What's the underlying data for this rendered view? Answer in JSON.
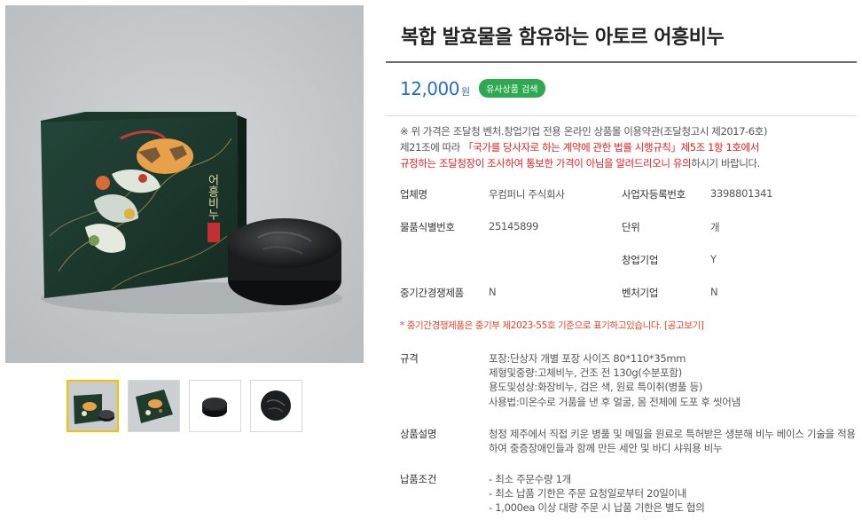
{
  "product": {
    "title": "복합 발효물을 함유하는 아토르 어흥비누",
    "price": "12,000",
    "currency": "원",
    "similar_button": "유사상품 검색"
  },
  "notice": {
    "line1": "※ 위 가격은 조달청 벤처.창업기업 전용 온라인 상품몰 이용약관(조달청고시 제2017-6호)",
    "line2_prefix": "제21조에 따라 ",
    "line2_red": "「국가를 당사자로 하는 계약에 관한 법률 시행규칙」제5조 1항 1호에서",
    "line3_red": "규정하는 조달청장이 조사하여 통보한 가격이 아님을 알려드리오니 유의",
    "line3_suffix": "하시기 바랍니다."
  },
  "info": {
    "company_label": "업체명",
    "company_value": "우컴퍼니 주식회사",
    "bizno_label": "사업자등록번호",
    "bizno_value": "3398801341",
    "itemno_label": "물품식별번호",
    "itemno_value": "25145899",
    "unit_label": "단위",
    "unit_value": "개",
    "startup_label": "창업기업",
    "startup_value": "Y",
    "smb_label": "중기간경쟁제품",
    "smb_value": "N",
    "venture_label": "벤처기업",
    "venture_value": "N"
  },
  "smb_note": "* 중기간경쟁제품은 중기부 제2023-55호 기준으로 표기하고있습니다. [공고보기]",
  "spec": {
    "label": "규격",
    "lines": [
      "포장:단상자 개별 포장 사이즈 80*110*35mm",
      "제형및중량:고체비누, 건조 전 130g(수분포함)",
      "용도및성상:화장비누, 검은 색, 원료 특이취(병풀 등)",
      "사용법:미온수로 거품을 낸 후 얼굴, 몸 전체에 도포 후 씻어냄"
    ]
  },
  "description": {
    "label": "상품설명",
    "text": "청정 제주에서 직접 키운 병풀 및 메밀을 원료로 특허받은 생분해 비누 베이스 기술을 적용하여 중증장애인들과 함께 만든 세안 및 바디 샤워용 비누"
  },
  "conditions": {
    "label": "납품조건",
    "lines": [
      "- 최소 주문수량 1개",
      "- 최소 납품 기한은 주문 요청일로부터 20일이내",
      "- 1,000ea 이상 대량 주문 시 납품 기한은 별도 협의"
    ]
  },
  "box_text": "어흥비누",
  "colors": {
    "price_blue": "#2a6cc0",
    "badge_green": "#2daa4f",
    "notice_red": "#e52222",
    "box_green": "#1f3b2c",
    "thumb_active": "#f2c200"
  },
  "thumbnails": [
    "box-with-soap",
    "box-angled",
    "soap-on-white",
    "soap-top-view"
  ]
}
